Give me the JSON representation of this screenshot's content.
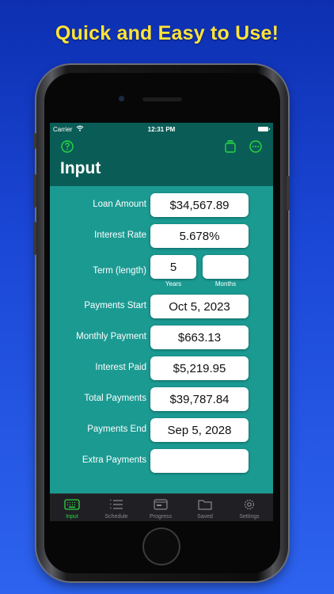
{
  "banner": {
    "headline": "Quick and Easy to Use!"
  },
  "status_bar": {
    "carrier": "Carrier",
    "time": "12:31 PM"
  },
  "nav": {
    "title": "Input",
    "help_icon": "help-circle-icon",
    "copy_icon": "copy-icon",
    "more_icon": "more-circle-icon"
  },
  "form": {
    "loan_amount": {
      "label": "Loan Amount",
      "value": "$34,567.89"
    },
    "interest_rate": {
      "label": "Interest Rate",
      "value": "5.678%"
    },
    "term": {
      "label": "Term (length)",
      "years_value": "5",
      "months_value": "",
      "years_label": "Years",
      "months_label": "Months"
    },
    "payments_start": {
      "label": "Payments Start",
      "value": "Oct 5, 2023"
    },
    "monthly_payment": {
      "label": "Monthly Payment",
      "value": "$663.13"
    },
    "interest_paid": {
      "label": "Interest Paid",
      "value": "$5,219.95"
    },
    "total_payments": {
      "label": "Total Payments",
      "value": "$39,787.84"
    },
    "payments_end": {
      "label": "Payments End",
      "value": "Sep 5, 2028"
    },
    "extra_payments": {
      "label": "Extra Payments",
      "value": ""
    }
  },
  "tabs": [
    {
      "label": "Input",
      "icon": "keyboard-icon",
      "active": true
    },
    {
      "label": "Schedule",
      "icon": "list-icon",
      "active": false
    },
    {
      "label": "Progress",
      "icon": "progress-icon",
      "active": false
    },
    {
      "label": "Saved",
      "icon": "folder-icon",
      "active": false
    },
    {
      "label": "Settings",
      "icon": "gear-icon",
      "active": false
    }
  ],
  "colors": {
    "background": "#1b47d6",
    "headline": "#ffe43a",
    "nav_background": "#0a5d56",
    "content_background": "#1b9a92",
    "accent_green": "#28d745",
    "tabbar_background": "#202024"
  }
}
